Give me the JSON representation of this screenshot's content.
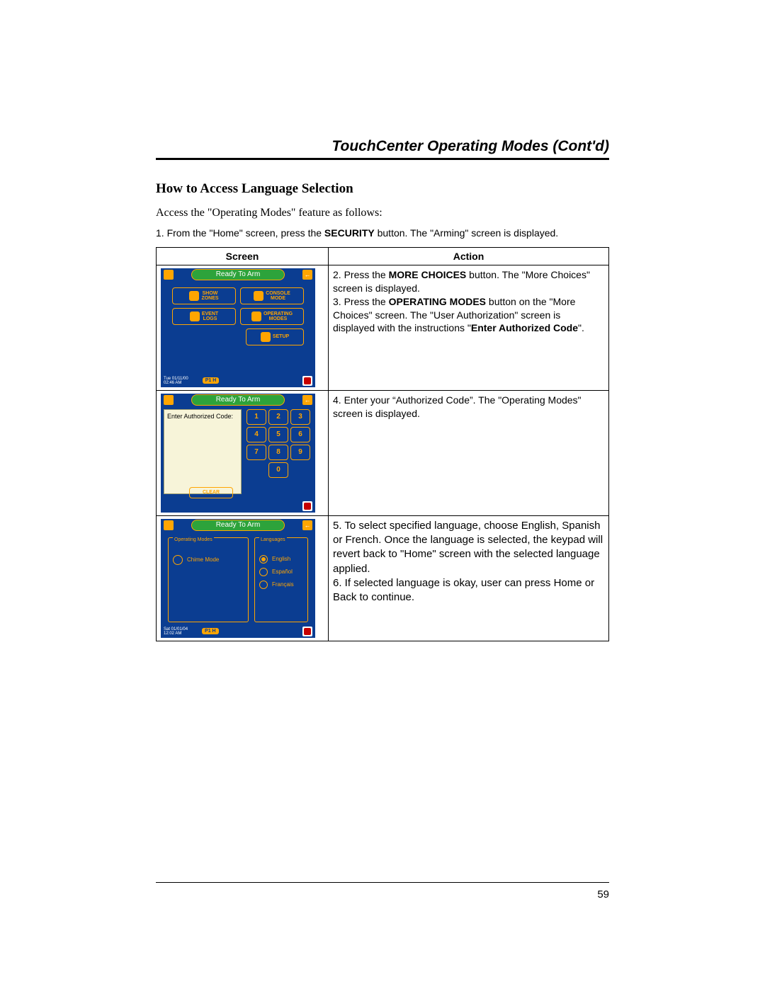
{
  "header": {
    "title": "TouchCenter Operating Modes (Cont'd)"
  },
  "section": {
    "heading": "How to Access Language Selection",
    "intro": "Access the \"Operating Modes\" feature as follows:",
    "step1_prefix": "1.  From the \"Home\" screen, press the ",
    "step1_bold": "SECURITY",
    "step1_suffix": " button.  The \"Arming\" screen is displayed."
  },
  "table": {
    "headers": {
      "screen": "Screen",
      "action": "Action"
    },
    "rows": [
      {
        "action_parts": {
          "a": "2.  Press the ",
          "b": "MORE CHOICES",
          "c": " button. The \"More Choices\" screen is displayed.",
          "d": "3.  Press the ",
          "e": "OPERATING MODES",
          "f": " button on the \"More Choices\" screen.  The \"User Authorization\" screen is displayed with the instructions \"",
          "g": "Enter Authorized Code",
          "h": "\"."
        }
      },
      {
        "action": "4.  Enter your “Authorized Code”.  The \"Operating Modes\" screen is displayed."
      },
      {
        "action_a": "5. To select specified language, choose English, Spanish or French. Once the language is selected, the keypad will revert back to \"Home\" screen with the selected language applied.",
        "action_b": "6. If selected language is okay, user can press Home or Back to continue."
      }
    ]
  },
  "screens": {
    "ready": "Ready To Arm",
    "s1": {
      "showZones": "SHOW\nZONES",
      "consoleMode": "CONSOLE\nMODE",
      "eventLogs": "EVENT\nLOGS",
      "operatingModes": "OPERATING\nMODES",
      "setup": "SETUP",
      "timestamp": "Tue 01/11/00\n02:46 AM",
      "pt": "P1 H"
    },
    "s2": {
      "prompt": "Enter Authorized Code:",
      "keys": [
        "1",
        "2",
        "3",
        "4",
        "5",
        "6",
        "7",
        "8",
        "9",
        "0"
      ],
      "clear": "CLEAR"
    },
    "s3": {
      "opModesTitle": "Operating Modes",
      "langTitle": "Languages",
      "chime": "Chime Mode",
      "english": "English",
      "spanish": "Español",
      "french": "Français",
      "timestamp": "Sat 01/01/04\n12:02 AM",
      "pt": "P1 H"
    }
  },
  "pageNumber": "59"
}
